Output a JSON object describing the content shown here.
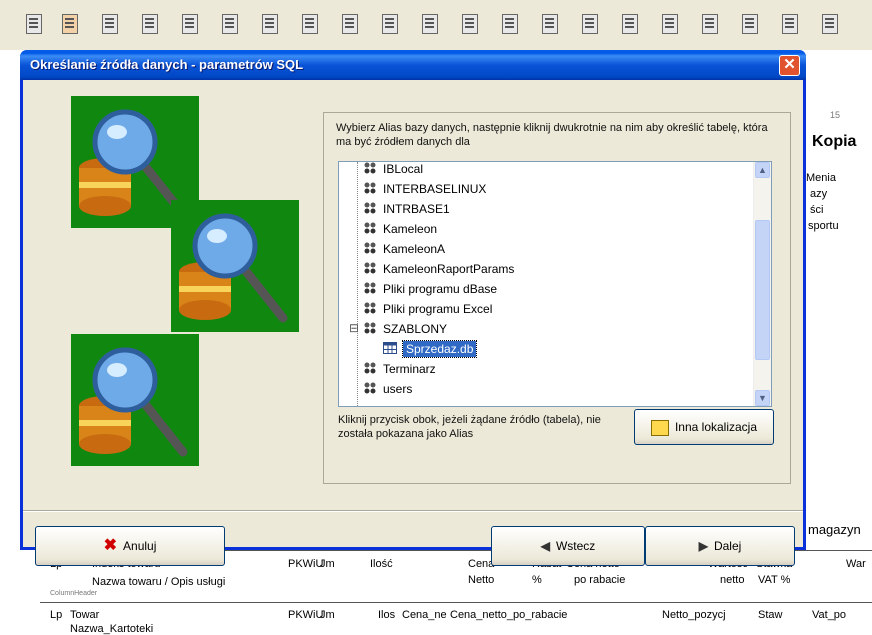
{
  "dialog": {
    "title": "Określanie źródła danych - parametrów SQL",
    "instruction": "Wybierz Alias bazy danych, następnie kliknij dwukrotnie na nim aby określić tabelę, która ma być źródłem danych dla",
    "hint": "Kliknij przycisk obok, jeżeli żądane źródło (tabela), nie została pokazana jako Alias",
    "tree_items": [
      {
        "label": "IBLocal",
        "type": "alias"
      },
      {
        "label": "INTERBASELINUX",
        "type": "alias"
      },
      {
        "label": "INTRBASE1",
        "type": "alias"
      },
      {
        "label": "Kameleon",
        "type": "alias"
      },
      {
        "label": "KameleonA",
        "type": "alias"
      },
      {
        "label": "KameleonRaportParams",
        "type": "alias"
      },
      {
        "label": "Pliki programu dBase",
        "type": "alias"
      },
      {
        "label": "Pliki programu Excel",
        "type": "alias"
      },
      {
        "label": "SZABLONY",
        "type": "alias",
        "expanded": true
      },
      {
        "label": "Sprzedaz.db",
        "type": "table",
        "selected": true
      },
      {
        "label": "Terminarz",
        "type": "alias"
      },
      {
        "label": "users",
        "type": "alias"
      }
    ],
    "buttons": {
      "other_location": "Inna lokalizacja",
      "cancel": "Anuluj",
      "back": "Wstecz",
      "next": "Dalej"
    },
    "icons": {
      "cancel": "red-x-icon",
      "back": "back-arrow-icon",
      "next": "next-arrow-icon",
      "other_location": "folder-icon"
    },
    "colors": {
      "title_bar": "#0054e3",
      "image_bg": "#108810",
      "selection": "#316ac5",
      "close_button": "#e1522e"
    }
  },
  "background": {
    "heading": "Kopia",
    "side_labels": [
      "Menia",
      "azy",
      "ści",
      "sportu"
    ],
    "magazyn": "magazyn",
    "header_row1": [
      "Lp",
      "Indeks towaru",
      "PKWiU",
      "Jm",
      "Ilość",
      "Cena",
      "Rabat",
      "Cena netto",
      "Wartość",
      "Stawka",
      "War"
    ],
    "header_row2": [
      "Nazwa towaru / Opis usługi",
      "Netto",
      "%",
      "po rabacie",
      "netto",
      "VAT %"
    ],
    "footer_label": "ColumnHeader",
    "data_row": [
      "Lp",
      "Towar",
      "PKWiU",
      "Jm",
      "Ilos",
      "Cena_ne",
      "Cena_netto_po_rabacie",
      "Netto_pozycj",
      "Staw",
      "Vat_po"
    ],
    "data_row2": "Nazwa_Kartoteki",
    "page_number": "15"
  }
}
